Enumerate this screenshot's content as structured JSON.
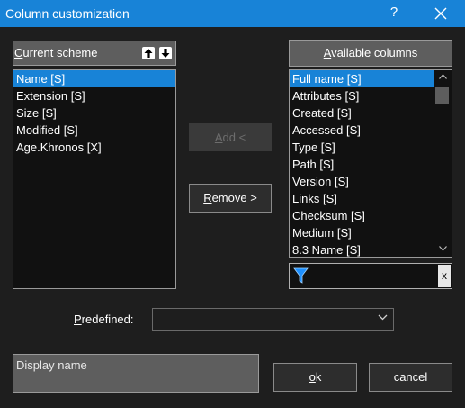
{
  "window": {
    "title": "Column customization",
    "help_label": "?",
    "title_bar_color": "#1883d7"
  },
  "current_scheme": {
    "header_prefix": "C",
    "header_rest": "urrent scheme",
    "items": [
      {
        "label": "Name [S]",
        "selected": true
      },
      {
        "label": "Extension [S]",
        "selected": false
      },
      {
        "label": "Size [S]",
        "selected": false
      },
      {
        "label": "Modified [S]",
        "selected": false
      },
      {
        "label": "Age.Khronos [X]",
        "selected": false
      }
    ]
  },
  "available_columns": {
    "header_prefix": "A",
    "header_rest": "vailable columns",
    "items": [
      {
        "label": "Full name [S]",
        "selected": true
      },
      {
        "label": "Attributes [S]",
        "selected": false
      },
      {
        "label": "Created [S]",
        "selected": false
      },
      {
        "label": "Accessed [S]",
        "selected": false
      },
      {
        "label": "Type [S]",
        "selected": false
      },
      {
        "label": "Path [S]",
        "selected": false
      },
      {
        "label": "Version [S]",
        "selected": false
      },
      {
        "label": "Links [S]",
        "selected": false
      },
      {
        "label": "Checksum [S]",
        "selected": false
      },
      {
        "label": "Medium [S]",
        "selected": false
      },
      {
        "label": "8.3 Name [S]",
        "selected": false
      }
    ]
  },
  "actions": {
    "add_prefix": "A",
    "add_rest": "dd <",
    "remove_prefix": "R",
    "remove_rest": "emove >"
  },
  "filter": {
    "icon": "filter-icon",
    "clear_label": "x",
    "value": ""
  },
  "predefined": {
    "label_prefix": "P",
    "label_rest": "redefined:",
    "selected_value": ""
  },
  "display_name": {
    "placeholder": "Display name"
  },
  "footer": {
    "ok_prefix": "o",
    "ok_rest": "k",
    "cancel_label": "cancel"
  },
  "colors": {
    "background": "#1e1e1e",
    "accent": "#1883d7",
    "list_background": "#111111",
    "header_background": "#5e5e5e"
  }
}
